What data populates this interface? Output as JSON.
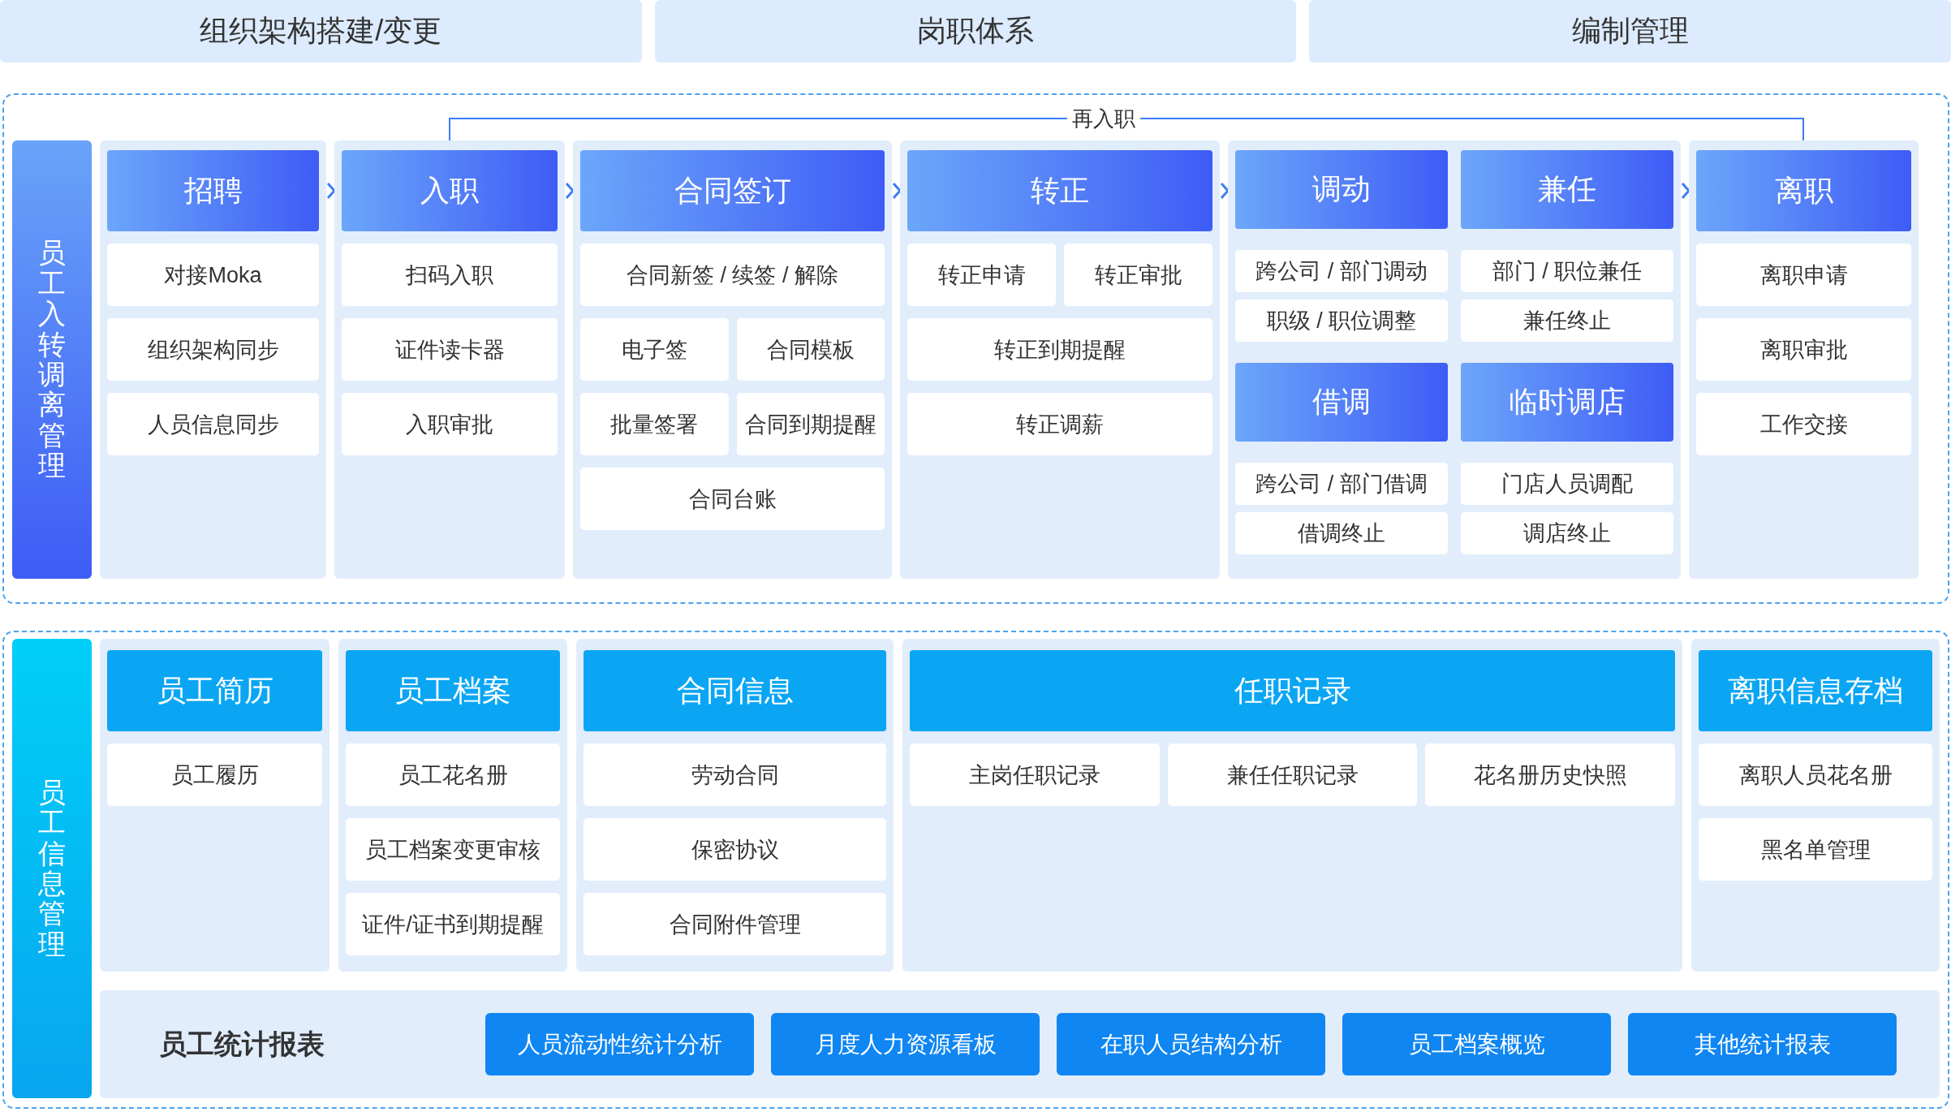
{
  "modules": [
    "组织架构搭建/变更",
    "岗职体系",
    "编制管理"
  ],
  "lifecycle": {
    "title": "员工入转调离管理",
    "reentry_label": "再入职",
    "stages": [
      {
        "kind": "list",
        "blocks": [
          {
            "header": "招聘",
            "rows": [
              [
                "对接Moka"
              ],
              [
                "组织架构同步"
              ],
              [
                "人员信息同步"
              ]
            ]
          }
        ]
      },
      {
        "kind": "list",
        "blocks": [
          {
            "header": "入职",
            "rows": [
              [
                "扫码入职"
              ],
              [
                "证件读卡器"
              ],
              [
                "入职审批"
              ]
            ]
          }
        ]
      },
      {
        "kind": "list",
        "blocks": [
          {
            "header": "合同签订",
            "rows": [
              [
                "合同新签 / 续签 / 解除"
              ],
              [
                "电子签",
                "合同模板"
              ],
              [
                "批量签署",
                "合同到期提醒"
              ],
              [
                "合同台账"
              ]
            ]
          }
        ]
      },
      {
        "kind": "list",
        "blocks": [
          {
            "header": "转正",
            "rows": [
              [
                "转正申请",
                "转正审批"
              ],
              [
                "转正到期提醒"
              ],
              [
                "转正调薪"
              ]
            ]
          }
        ]
      },
      {
        "kind": "grid",
        "blocks": [
          {
            "header": "调动",
            "rows": [
              [
                "跨公司 / 部门调动"
              ],
              [
                "职级 / 职位调整"
              ]
            ]
          },
          {
            "header": "兼任",
            "rows": [
              [
                "部门 / 职位兼任"
              ],
              [
                "兼任终止"
              ]
            ]
          },
          {
            "header": "借调",
            "rows": [
              [
                "跨公司 / 部门借调"
              ],
              [
                "借调终止"
              ]
            ]
          },
          {
            "header": "临时调店",
            "rows": [
              [
                "门店人员调配"
              ],
              [
                "调店终止"
              ]
            ]
          }
        ]
      },
      {
        "kind": "list",
        "blocks": [
          {
            "header": "离职",
            "rows": [
              [
                "离职申请"
              ],
              [
                "离职审批"
              ],
              [
                "工作交接"
              ]
            ]
          }
        ]
      }
    ]
  },
  "records": {
    "title": "员工信息管理",
    "groups": [
      {
        "header": "员工简历",
        "rows": [
          [
            "员工履历"
          ]
        ]
      },
      {
        "header": "员工档案",
        "rows": [
          [
            "员工花名册"
          ],
          [
            "员工档案变更审核"
          ],
          [
            "证件/证书到期提醒"
          ]
        ]
      },
      {
        "header": "合同信息",
        "rows": [
          [
            "劳动合同"
          ],
          [
            "保密协议"
          ],
          [
            "合同附件管理"
          ]
        ]
      },
      {
        "header": "任职记录",
        "rows": [
          [
            "主岗任职记录",
            "兼任任职记录",
            "花名册历史快照"
          ]
        ]
      },
      {
        "header": "离职信息存档",
        "rows": [
          [
            "离职人员花名册"
          ],
          [
            "黑名单管理"
          ]
        ]
      }
    ],
    "reports": {
      "title": "员工统计报表",
      "buttons": [
        "人员流动性统计分析",
        "月度人力资源看板",
        "在职人员结构分析",
        "员工档案概览",
        "其他统计报表"
      ]
    }
  }
}
